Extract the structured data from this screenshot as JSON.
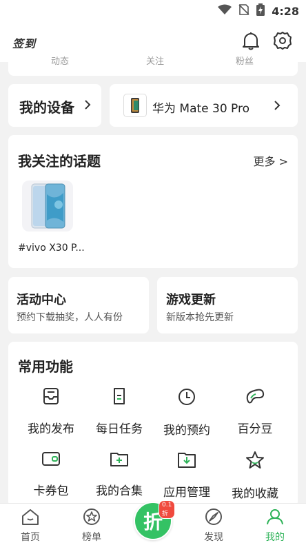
{
  "status_bar": {
    "time": "4:28"
  },
  "header": {
    "signin_label": "签到"
  },
  "peek_row": {
    "items": [
      "动态",
      "关注",
      "粉丝"
    ]
  },
  "device": {
    "title": "我的设备",
    "model": "华为 Mate 30 Pro"
  },
  "topics": {
    "title": "我关注的话题",
    "more_label": "更多 >",
    "items": [
      {
        "name": "#vivo X30 P..."
      }
    ]
  },
  "promos": {
    "activity": {
      "title": "活动中心",
      "subtitle": "预约下载抽奖，人人有份"
    },
    "games": {
      "title": "游戏更新",
      "subtitle": "新版本抢先更新"
    }
  },
  "functions": {
    "title": "常用功能",
    "items": [
      {
        "label": "我的发布",
        "icon": "publish-icon"
      },
      {
        "label": "每日任务",
        "icon": "task-icon"
      },
      {
        "label": "我的预约",
        "icon": "clock-icon"
      },
      {
        "label": "百分豆",
        "icon": "bean-icon"
      },
      {
        "label": "卡券包",
        "icon": "wallet-icon"
      },
      {
        "label": "我的合集",
        "icon": "collection-icon"
      },
      {
        "label": "应用管理",
        "icon": "download-folder-icon"
      },
      {
        "label": "我的收藏",
        "icon": "star-icon"
      }
    ]
  },
  "bottom_nav": {
    "items": [
      {
        "label": "首页",
        "icon": "home-icon"
      },
      {
        "label": "榜单",
        "icon": "ranking-icon"
      },
      {
        "label": "",
        "icon": "discount-icon"
      },
      {
        "label": "发现",
        "icon": "discover-icon"
      },
      {
        "label": "我的",
        "icon": "profile-icon",
        "active": true
      }
    ],
    "center": {
      "glyph": "折",
      "badge": "0.1折"
    }
  },
  "colors": {
    "accent": "#2fb359",
    "badge": "#f04a3e"
  }
}
